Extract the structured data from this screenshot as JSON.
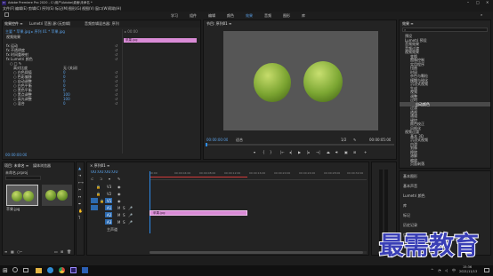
{
  "titlebar": {
    "title": "Adobe Premiere Pro 2020 - C:\\用户\\Adobe\\桌面\\未命名 *"
  },
  "menubar": {
    "items": [
      "文件(F)",
      "编辑(E)",
      "剪辑(C)",
      "序列(S)",
      "标记(M)",
      "图形(G)",
      "视图(V)",
      "窗口(W)",
      "帮助(H)"
    ]
  },
  "workspaces": {
    "items": [
      "学习",
      "组件",
      "编辑",
      "颜色",
      "效果",
      "音频",
      "图形",
      "库"
    ],
    "active_index": 4
  },
  "effect_controls": {
    "tabs": [
      "效果控件 ≡",
      "Lumetri 范围",
      "源:(无剪辑)",
      "音频剪辑混合器: 序列"
    ],
    "source_line": "主要 * 苹果.jpg ▸ 序列 01 * 苹果.jpg",
    "section_video": "视频效果",
    "clip_label": "苹果.jpg",
    "rows": [
      {
        "label": "fx 运动",
        "value": ""
      },
      {
        "label": "fx 不透明度",
        "value": ""
      },
      {
        "label": "fx 时间重映射",
        "value": ""
      },
      {
        "label": "fx Lumetri 颜色",
        "value": ""
      },
      {
        "label": "○ □ ✎",
        "value": ""
      },
      {
        "label": "高对比度",
        "value": "无 (关闭)"
      },
      {
        "label": "○ 白色阈值",
        "value": "0"
      },
      {
        "label": "○ 色彩偏移",
        "value": "0"
      },
      {
        "label": "○ 自动调整",
        "value": "0"
      },
      {
        "label": "○ 白色平衡",
        "value": "0"
      },
      {
        "label": "○ 黑色平衡",
        "value": "0"
      },
      {
        "label": "○ 黑点调整",
        "value": "100"
      },
      {
        "label": "○ 高光调整",
        "value": "100"
      },
      {
        "label": "○ 混合",
        "value": "0"
      }
    ],
    "timecode": "00:00:00:00"
  },
  "program_monitor": {
    "title": "节目: 序列01 ≡",
    "timecode": "00:00:00:00",
    "fit": "适合",
    "zoom": "1/2",
    "duration": "00:00:05:00"
  },
  "effects_panel": {
    "title": "效果 ≡",
    "items": [
      {
        "label": "预设",
        "level": 0
      },
      {
        "label": "Lumetri 预设",
        "level": 0
      },
      {
        "label": "音频效果",
        "level": 0
      },
      {
        "label": "音频过渡",
        "level": 0
      },
      {
        "label": "视频效果",
        "level": 0
      },
      {
        "label": "变换",
        "level": 1
      },
      {
        "label": "图像控制",
        "level": 1
      },
      {
        "label": "实用程序",
        "level": 1
      },
      {
        "label": "扭曲",
        "level": 1
      },
      {
        "label": "时间",
        "level": 1
      },
      {
        "label": "杂色与颗粒",
        "level": 1
      },
      {
        "label": "模糊与锐化",
        "level": 1
      },
      {
        "label": "沉浸式视频",
        "level": 1
      },
      {
        "label": "生成",
        "level": 1
      },
      {
        "label": "视频",
        "level": 1
      },
      {
        "label": "调整",
        "level": 1
      },
      {
        "label": "过时",
        "level": 1
      },
      {
        "label": "自动颜色",
        "level": 2,
        "selected": true
      },
      {
        "label": "过渡",
        "level": 1
      },
      {
        "label": "透视",
        "level": 1
      },
      {
        "label": "通道",
        "level": 1
      },
      {
        "label": "键控",
        "level": 1
      },
      {
        "label": "颜色校正",
        "level": 1
      },
      {
        "label": "风格化",
        "level": 1
      },
      {
        "label": "视频过渡",
        "level": 0
      },
      {
        "label": "基本 3D",
        "level": 1
      },
      {
        "label": "沉浸式视频",
        "level": 1
      },
      {
        "label": "内滑",
        "level": 1
      },
      {
        "label": "划像",
        "level": 1
      },
      {
        "label": "擦除",
        "level": 1
      },
      {
        "label": "溶解",
        "level": 1
      },
      {
        "label": "缩放",
        "level": 1
      },
      {
        "label": "页面剥落",
        "level": 1
      }
    ]
  },
  "project_panel": {
    "tabs": [
      "项目: 未命名 ≡",
      "媒体浏览器"
    ],
    "project_file": "未命名.prproj",
    "items": [
      {
        "label": "苹果.jpg"
      },
      {
        "label": ""
      }
    ]
  },
  "timeline": {
    "title": "× 序列01 ≡",
    "timecode": "00:00:00:00",
    "ruler": [
      "00:00",
      "00:00:04:00",
      "00:00:08:00",
      "00:00:12:00",
      "00:00:16:00",
      "00:00:20:00",
      "00:00:24:00",
      "00:00:28:00",
      "00:00:32:00"
    ],
    "tracks": [
      {
        "name": "V3"
      },
      {
        "name": "V2"
      },
      {
        "name": "V1"
      },
      {
        "name": "A1"
      },
      {
        "name": "A2"
      },
      {
        "name": "A3"
      }
    ],
    "master": "主声道",
    "clip_label": "苹果.jpg"
  },
  "essential_panel": {
    "items": [
      "基本图形",
      "基本声音",
      "Lumetri 颜色",
      "库",
      "标记",
      "历史记录",
      "信息",
      "Lumetri 范围"
    ]
  },
  "taskbar": {
    "clock": "15:36",
    "date": "2021/11/13",
    "lang": "中"
  },
  "watermark": {
    "text": "最需教育"
  },
  "colors": {
    "accent_blue": "#2d8ceb",
    "clip_pink": "#d98bd6",
    "playhead_red": "#d33a3a"
  }
}
